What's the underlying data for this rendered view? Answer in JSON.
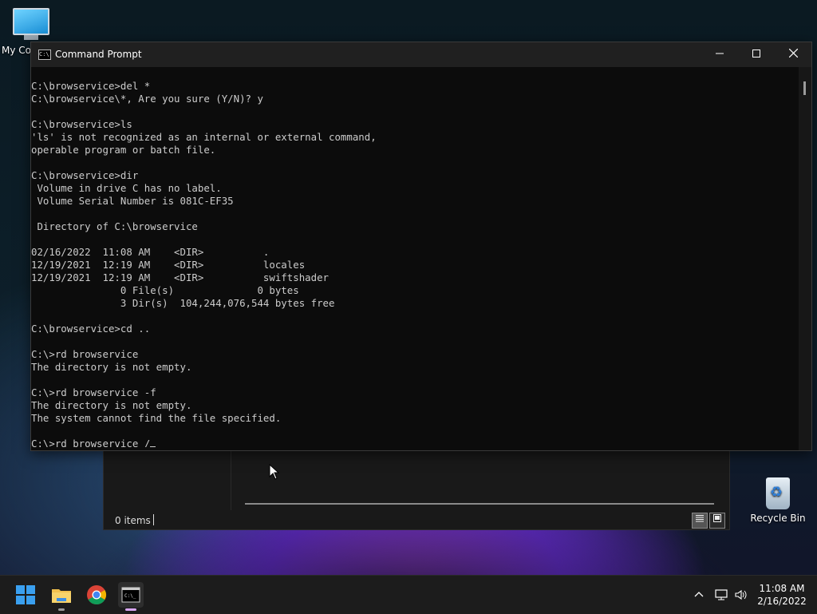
{
  "desktop": {
    "icons": [
      {
        "label": "My Co"
      },
      {
        "label": "Recycle Bin"
      }
    ]
  },
  "explorer": {
    "status_count": "0 items"
  },
  "cmd": {
    "title": "Command Prompt",
    "icon_text": "C:\\",
    "lines": [
      "C:\\browservice>del *",
      "C:\\browservice\\*, Are you sure (Y/N)? y",
      "",
      "C:\\browservice>ls",
      "'ls' is not recognized as an internal or external command,",
      "operable program or batch file.",
      "",
      "C:\\browservice>dir",
      " Volume in drive C has no label.",
      " Volume Serial Number is 081C-EF35",
      "",
      " Directory of C:\\browservice",
      "",
      "02/16/2022  11:08 AM    <DIR>          .",
      "12/19/2021  12:19 AM    <DIR>          locales",
      "12/19/2021  12:19 AM    <DIR>          swiftshader",
      "               0 File(s)              0 bytes",
      "               3 Dir(s)  104,244,076,544 bytes free",
      "",
      "C:\\browservice>cd ..",
      "",
      "C:\\>rd browservice",
      "The directory is not empty.",
      "",
      "C:\\>rd browservice -f",
      "The directory is not empty.",
      "The system cannot find the file specified.",
      ""
    ],
    "current_input": "C:\\>rd browservice /"
  },
  "taskbar": {
    "apps": [
      "start-icon",
      "file-explorer-icon",
      "chrome-icon",
      "command-prompt-icon"
    ],
    "tray": [
      "chevron-up-icon",
      "network-icon",
      "volume-icon"
    ],
    "time": "11:08 AM",
    "date": "2/16/2022"
  },
  "colors": {
    "console_bg": "#0c0c0c",
    "console_fg": "#cccccc",
    "titlebar": "#202020",
    "taskbar": "#1c1c1c"
  }
}
